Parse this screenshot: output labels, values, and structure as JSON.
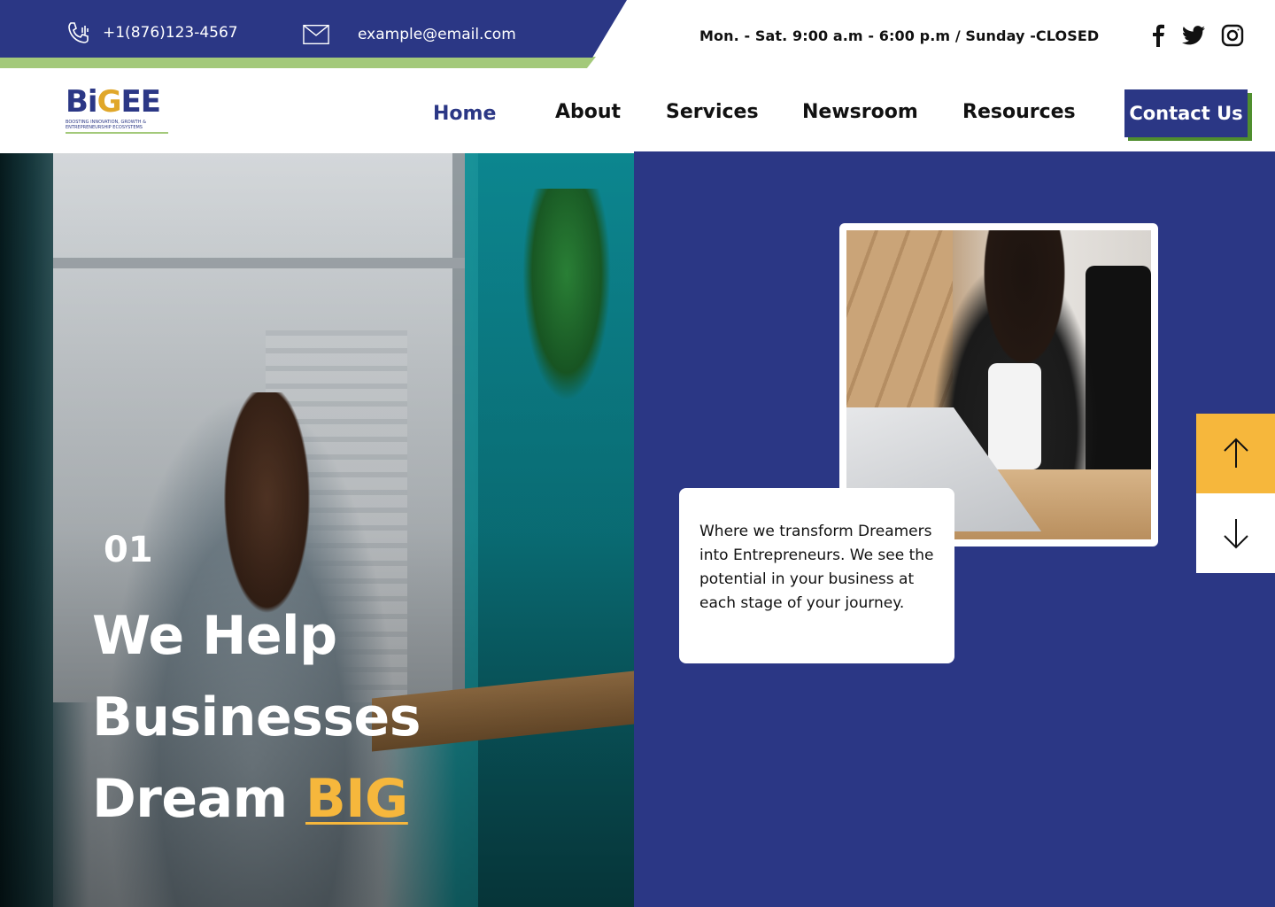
{
  "topbar": {
    "phone": "+1(876)123-4567",
    "email": "example@email.com",
    "hours": "Mon. - Sat. 9:00 a.m - 6:00 p.m / Sunday -CLOSED",
    "social": [
      "facebook-icon",
      "twitter-icon",
      "instagram-icon"
    ]
  },
  "logo": {
    "word_prefix": "Bi",
    "word_g": "G",
    "word_suffix": "EE",
    "tagline": "BOOSTING INNOVATION, GROWTH & ENTREPRENEURSHIP ECOSYSTEMS"
  },
  "nav": {
    "items": [
      {
        "label": "Home",
        "active": true
      },
      {
        "label": "About"
      },
      {
        "label": "Services"
      },
      {
        "label": "Newsroom"
      },
      {
        "label": "Resources"
      }
    ],
    "cta": "Contact Us"
  },
  "hero": {
    "slide_number": "01",
    "headline_line1": "We Help",
    "headline_line2": "Businesses",
    "headline_line3_prefix": "Dream ",
    "headline_highlight": "BIG",
    "quote": "Where we transform Dreamers into Entrepreneurs. We see the potential in your business at each stage of your journey."
  },
  "colors": {
    "brand_blue": "#2b3785",
    "accent_yellow": "#f6b73c",
    "accent_green": "#a3c97a",
    "cta_shadow_green": "#4f8e2e"
  },
  "slider_controls": [
    "arrow-up-icon",
    "arrow-down-icon"
  ]
}
